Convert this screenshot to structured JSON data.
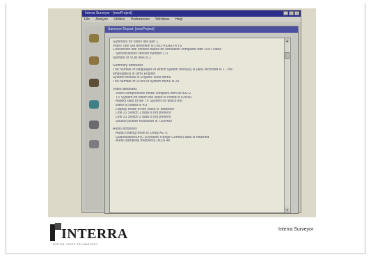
{
  "app": {
    "title": "Interra Surveyor - [newProject]",
    "menu": [
      "File",
      "Analyze",
      "Utilities",
      "Preferences",
      "Windows",
      "Help"
    ],
    "window_buttons": [
      "_",
      "□",
      "×"
    ]
  },
  "doc_window": {
    "title": "Surveyor Report: [newProject]",
    "lines": [
      {
        "text": "Summary for video title part 1",
        "indent": false
      },
      {
        "text": "Video Title Set definition is DVD-VIDEO-VTS",
        "indent": false
      },
      {
        "text": "Conversion title version based on emulation compliant with DVD Video",
        "indent": false
      },
      {
        "text": "Specifications version number 1.0",
        "indent": true
      },
      {
        "text": "Number of VOB files is 2",
        "indent": false
      },
      {
        "text": "",
        "indent": false
      },
      {
        "text": "Summary attributes",
        "indent": false
      },
      {
        "text": "The number of languages in which system menu(s) is (are) recorded is 1. The",
        "indent": false
      },
      {
        "text": "language(s) is (are) English",
        "indent": false
      },
      {
        "text": "System Menus in English: Root Menu",
        "indent": false
      },
      {
        "text": "The number of VOBs in system menu is 20",
        "indent": false
      },
      {
        "text": "",
        "indent": false
      },
      {
        "text": "Video attributes",
        "indent": false
      },
      {
        "text": "Video compression mode complies with MPEG-2",
        "indent": true
      },
      {
        "text": "TV System for which the video is coded is 525/60",
        "indent": true
      },
      {
        "text": "Aspect ratio of the TV System for which the",
        "indent": true
      },
      {
        "text": "video is coded is 4:3",
        "indent": true
      },
      {
        "text": "Display mode of the video is 'letterbox'",
        "indent": true
      },
      {
        "text": "Line 21 Switch 1 data is not present",
        "indent": true
      },
      {
        "text": "Line 21 Switch 2 data is not present",
        "indent": true
      },
      {
        "text": "Source picture resolution is 720x480",
        "indent": true
      },
      {
        "text": "",
        "indent": false
      },
      {
        "text": "Audio attributes",
        "indent": false
      },
      {
        "text": "Audio coding mode is Dolby AC-3",
        "indent": true
      },
      {
        "text": "Quantization/DRC (Dynamic Range Control) data is returned",
        "indent": true
      },
      {
        "text": "Audio sampling frequency (fs) is 48",
        "indent": true
      }
    ]
  },
  "toolbar": {
    "tools": [
      {
        "icon": "folder-icon",
        "color": "#8c7a3e"
      },
      {
        "icon": "open-folder-icon",
        "color": "#8c7440"
      },
      {
        "icon": "tools-icon",
        "color": "#5b4d38"
      },
      {
        "icon": "globe-icon",
        "color": "#3f7f86"
      },
      {
        "icon": "question-icon",
        "color": "#6a6a70"
      },
      {
        "icon": "settings-icon",
        "color": "#7c7c80"
      }
    ]
  },
  "logo": {
    "text": "INTERRA",
    "tagline": "DIGITAL VIDEO TECHNOLOGY"
  },
  "caption": "Interra Surveyor"
}
